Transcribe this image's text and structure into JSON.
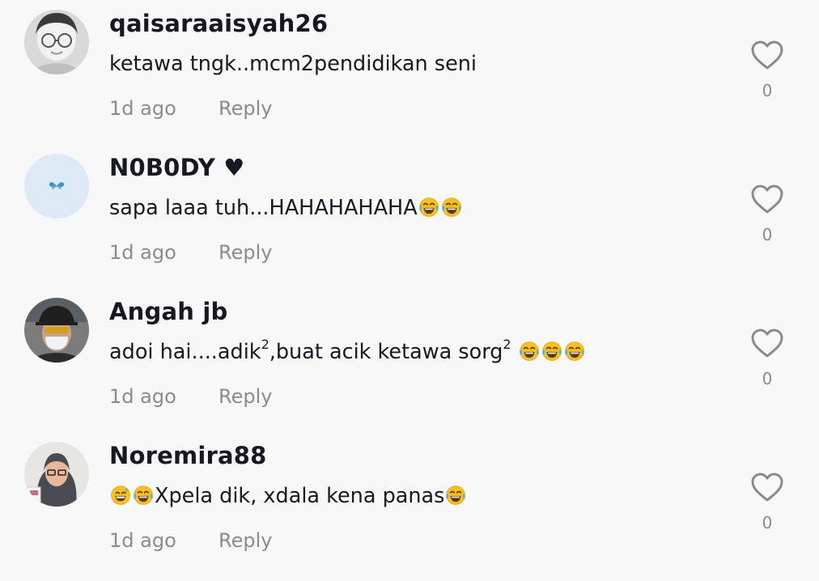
{
  "comments": [
    {
      "username": "qaisaraaisyah26",
      "text": "ketawa tngk..mcm2pendidikan seni",
      "time": "1d ago",
      "reply_label": "Reply",
      "likes": "0",
      "avatar": "woman-with-glasses-avatar"
    },
    {
      "username": "N0B0DY ♥",
      "text": "sapa laaa tuh...HAHAHAHAHA",
      "time": "1d ago",
      "reply_label": "Reply",
      "likes": "0",
      "avatar": "butterfly-avatar"
    },
    {
      "username": "Angah jb",
      "text_before": "adoi hai....adik",
      "sup1": "2",
      "text_middle": ",buat acik ketawa sorg",
      "sup2": "2",
      "time": "1d ago",
      "reply_label": "Reply",
      "likes": "0",
      "avatar": "man-with-cap-and-mask-avatar"
    },
    {
      "username": "Noremira88",
      "text": "Xpela dik, xdala kena panas",
      "time": "1d ago",
      "reply_label": "Reply",
      "likes": "0",
      "avatar": "woman-in-hijab-avatar"
    }
  ],
  "emoji": "face-with-tears-of-joy-icon",
  "emoji_alt": "grinning-sweat-icon",
  "colors": {
    "background": "#f8f8f8",
    "text": "#161823",
    "secondary": "#8a8b91",
    "emoji_yellow": "#fcc21b",
    "tears_blue": "#4fb3e8"
  }
}
